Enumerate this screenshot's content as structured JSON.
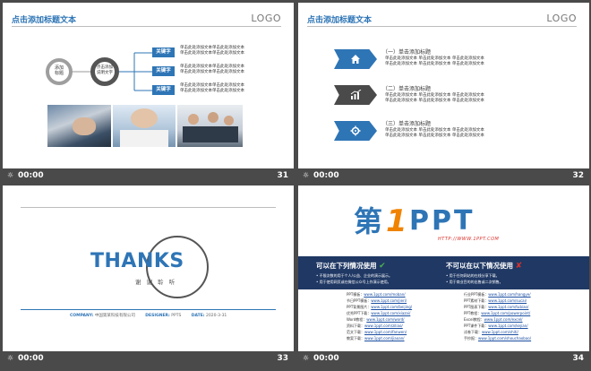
{
  "time_display": "00:00",
  "play_icon": "presentation-play-icon",
  "colors": {
    "accent": "#2e75b6",
    "dark": "#3a3a3a",
    "navy": "#1f3864",
    "orange": "#f08300",
    "green": "#4caf50",
    "red": "#d9312b"
  },
  "slide31": {
    "number": "31",
    "title": "点击添加标题文本",
    "logo": "LOGO",
    "node_left": "添加\n标题",
    "node_center": "点击添加\n说明文字",
    "keyword": "关键字",
    "desc_line": "单击此处添加文本单击此处添加文本",
    "photos": [
      "hand-writing-photo",
      "team-high-five-photo",
      "business-meeting-photo"
    ]
  },
  "slide32": {
    "number": "32",
    "title": "点击添加标题文本",
    "logo": "LOGO",
    "items": [
      {
        "heading": "（一）单击添加标题",
        "icon": "home-icon",
        "style": "blue"
      },
      {
        "heading": "（二）单击添加标题",
        "icon": "bar-chart-icon",
        "style": "dark"
      },
      {
        "heading": "（三）单击添加标题",
        "icon": "cogs-icon",
        "style": "blue"
      }
    ],
    "body_line": "单击此处添加文本    单击此处添加文本    单击此处添加文本"
  },
  "slide33": {
    "number": "33",
    "thanks": "THANKS",
    "thanks_cn": "谢 谢 聆 听",
    "company_label": "COMPANY:",
    "company_value": "中国第某科技有限公司",
    "designer_label": "DESIGNER:",
    "designer_value": "PPTS",
    "date_label": "DATE:",
    "date_value": "2020-3-31"
  },
  "slide34": {
    "number": "34",
    "logo_di": "第",
    "logo_one": "1",
    "logo_ppt": "PPT",
    "logo_url": "HTTP://WWW.1PPT.COM",
    "can_title": "可以在下列情况使用",
    "cannot_title": "不可以在以下情况使用",
    "can_items": [
      "不限次数的用于个人/公益、企业的演示展示。",
      "用于使用网页或在微信公众号上作演示使用。"
    ],
    "cannot_items": [
      "用于任何网站的在线分享下载。",
      "用于商业目的的出售或二次销售。"
    ],
    "left_links": [
      {
        "label": "PPT模板：",
        "url": "www.1ppt.com/moban/"
      },
      {
        "label": "节日PPT模板：",
        "url": "www.1ppt.com/jieri/"
      },
      {
        "label": "PPT背景图片：",
        "url": "www.1ppt.com/beijing/"
      },
      {
        "label": "优秀PPT下载：",
        "url": "www.1ppt.com/xiazai/"
      },
      {
        "label": "Word教程：",
        "url": "www.1ppt.com/word/"
      },
      {
        "label": "资料下载：",
        "url": "www.1ppt.com/ziliao/"
      },
      {
        "label": "范文下载：",
        "url": "www.1ppt.com/fanwen/"
      },
      {
        "label": "教案下载：",
        "url": "www.1ppt.com/jiaoan/"
      }
    ],
    "right_links": [
      {
        "label": "行业PPT模板：",
        "url": "www.1ppt.com/hangye/"
      },
      {
        "label": "PPT素材下载：",
        "url": "www.1ppt.com/sucai/"
      },
      {
        "label": "PPT图表下载：",
        "url": "www.1ppt.com/tubiao/"
      },
      {
        "label": "PPT教程：",
        "url": "www.1ppt.com/powerpoint/"
      },
      {
        "label": "Excel教程：",
        "url": "www.1ppt.com/excel/"
      },
      {
        "label": "PPT课件下载：",
        "url": "www.1ppt.com/kejian/"
      },
      {
        "label": "试卷下载：",
        "url": "www.1ppt.com/shiti/"
      },
      {
        "label": "手抄报：",
        "url": "www.1ppt.com/shouchaobao/"
      }
    ]
  }
}
